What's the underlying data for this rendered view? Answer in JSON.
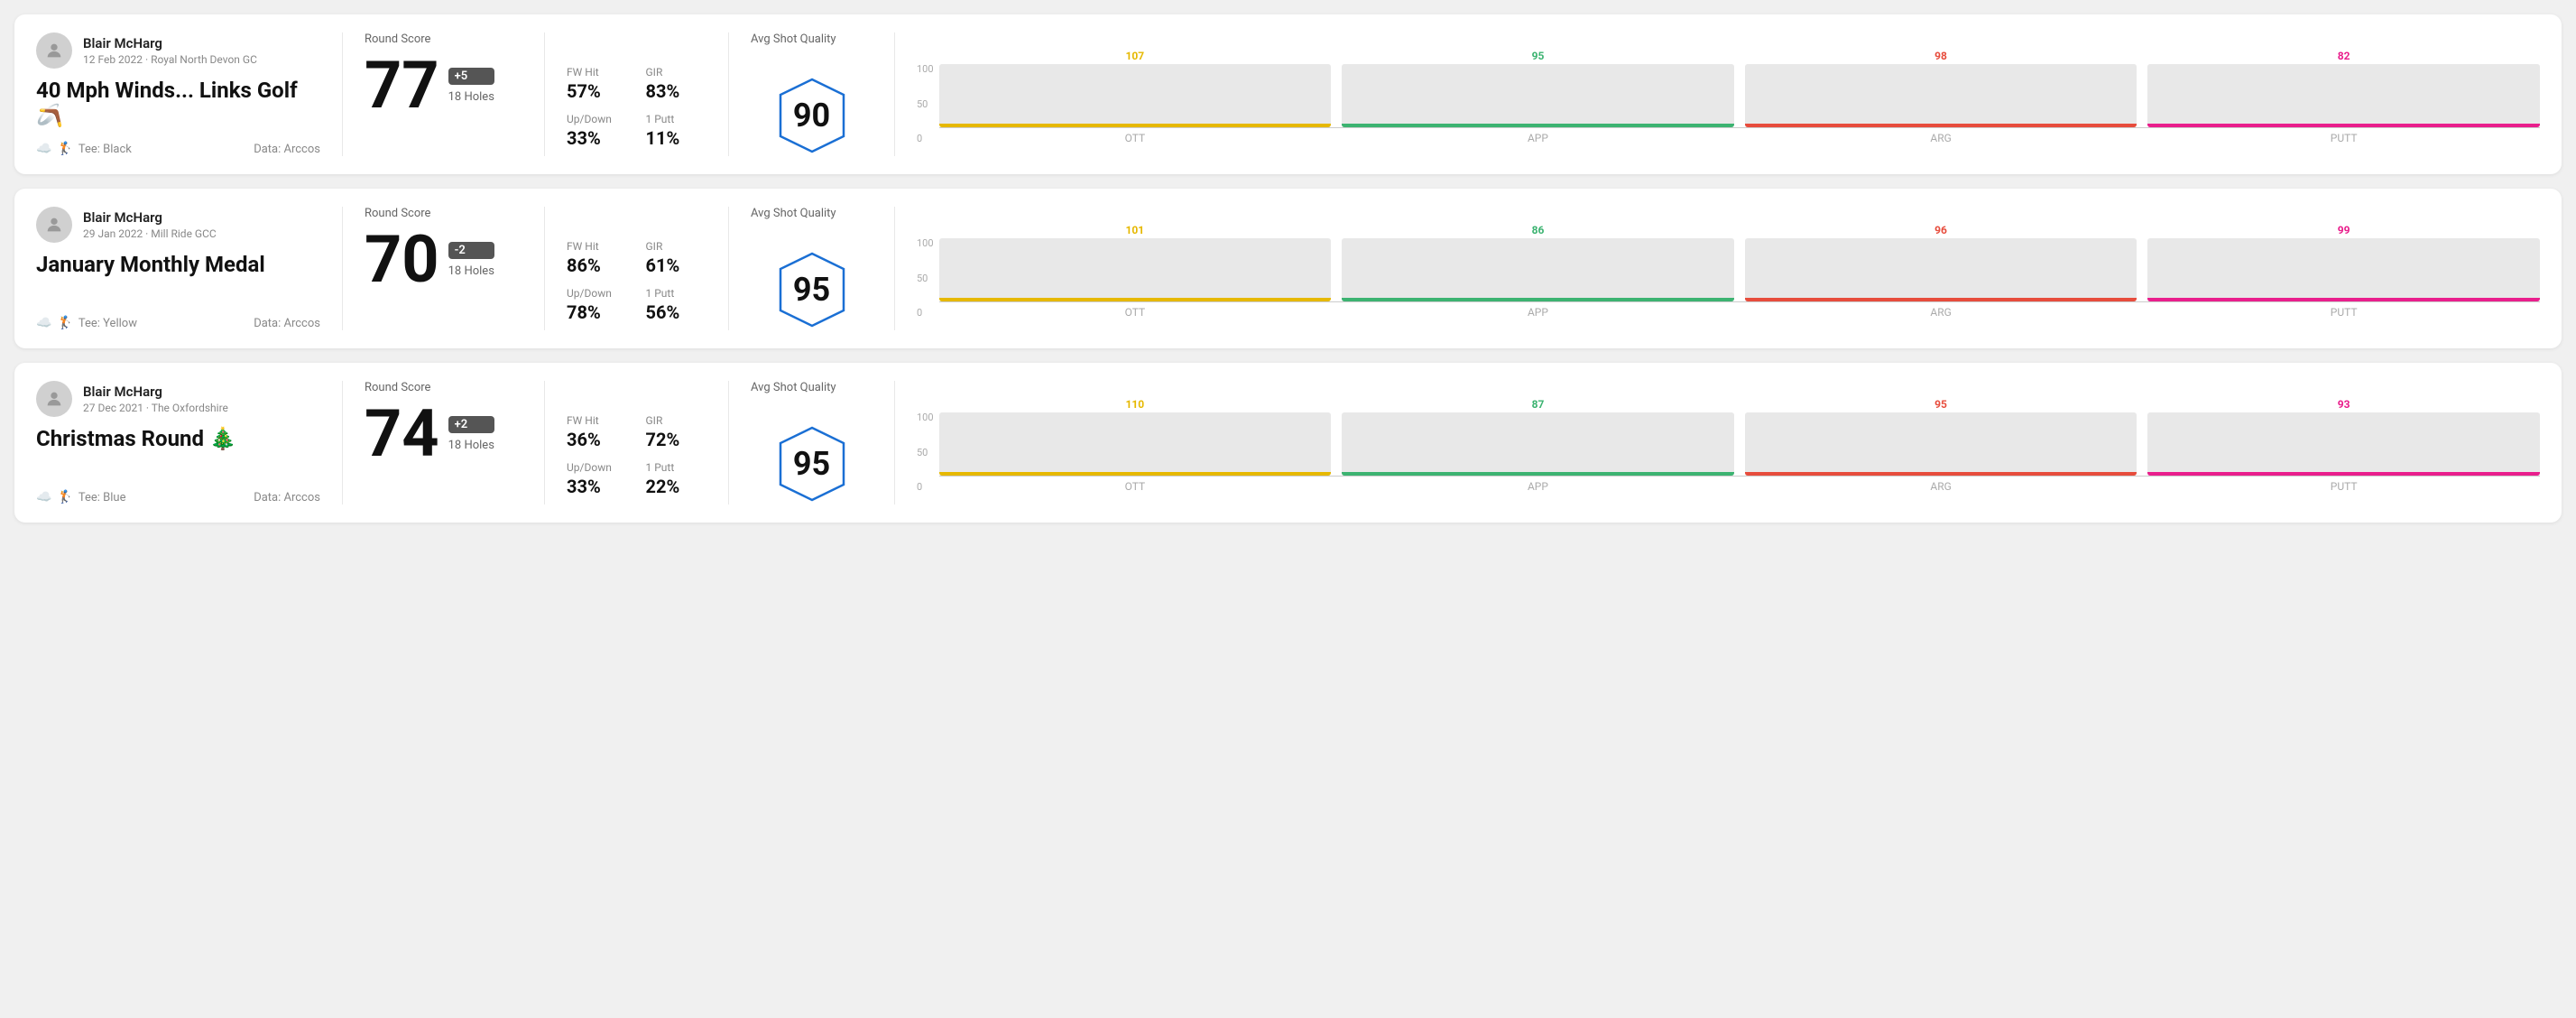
{
  "rounds": [
    {
      "id": "round-1",
      "user": {
        "name": "Blair McHarg",
        "date_course": "12 Feb 2022 · Royal North Devon GC"
      },
      "title": "40 Mph Winds... Links Golf 🪃",
      "tee": "Black",
      "data_source": "Data: Arccos",
      "score": "77",
      "score_badge": "+5",
      "score_holes": "18 Holes",
      "fw_hit": "57%",
      "gir": "83%",
      "up_down": "33%",
      "one_putt": "11%",
      "avg_shot_quality_label": "Avg Shot Quality",
      "avg_shot_quality": "90",
      "chart": {
        "bars": [
          {
            "label": "OTT",
            "value": 107,
            "color": "#e6b800",
            "fill_pct": 80
          },
          {
            "label": "APP",
            "value": 95,
            "color": "#3cb371",
            "fill_pct": 65
          },
          {
            "label": "ARG",
            "value": 98,
            "color": "#e74c3c",
            "fill_pct": 70
          },
          {
            "label": "PUTT",
            "value": 82,
            "color": "#e91e8c",
            "fill_pct": 55
          }
        ]
      }
    },
    {
      "id": "round-2",
      "user": {
        "name": "Blair McHarg",
        "date_course": "29 Jan 2022 · Mill Ride GCC"
      },
      "title": "January Monthly Medal",
      "tee": "Yellow",
      "data_source": "Data: Arccos",
      "score": "70",
      "score_badge": "-2",
      "score_holes": "18 Holes",
      "fw_hit": "86%",
      "gir": "61%",
      "up_down": "78%",
      "one_putt": "56%",
      "avg_shot_quality_label": "Avg Shot Quality",
      "avg_shot_quality": "95",
      "chart": {
        "bars": [
          {
            "label": "OTT",
            "value": 101,
            "color": "#e6b800",
            "fill_pct": 78
          },
          {
            "label": "APP",
            "value": 86,
            "color": "#3cb371",
            "fill_pct": 60
          },
          {
            "label": "ARG",
            "value": 96,
            "color": "#e74c3c",
            "fill_pct": 72
          },
          {
            "label": "PUTT",
            "value": 99,
            "color": "#e91e8c",
            "fill_pct": 75
          }
        ]
      }
    },
    {
      "id": "round-3",
      "user": {
        "name": "Blair McHarg",
        "date_course": "27 Dec 2021 · The Oxfordshire"
      },
      "title": "Christmas Round 🎄",
      "tee": "Blue",
      "data_source": "Data: Arccos",
      "score": "74",
      "score_badge": "+2",
      "score_holes": "18 Holes",
      "fw_hit": "36%",
      "gir": "72%",
      "up_down": "33%",
      "one_putt": "22%",
      "avg_shot_quality_label": "Avg Shot Quality",
      "avg_shot_quality": "95",
      "chart": {
        "bars": [
          {
            "label": "OTT",
            "value": 110,
            "color": "#e6b800",
            "fill_pct": 85
          },
          {
            "label": "APP",
            "value": 87,
            "color": "#3cb371",
            "fill_pct": 62
          },
          {
            "label": "ARG",
            "value": 95,
            "color": "#e74c3c",
            "fill_pct": 72
          },
          {
            "label": "PUTT",
            "value": 93,
            "color": "#e91e8c",
            "fill_pct": 70
          }
        ]
      }
    }
  ],
  "labels": {
    "round_score": "Round Score",
    "fw_hit": "FW Hit",
    "gir": "GIR",
    "up_down": "Up/Down",
    "one_putt": "1 Putt",
    "avg_shot_quality": "Avg Shot Quality",
    "tee_prefix": "Tee: ",
    "y_axis": [
      "100",
      "50",
      "0"
    ]
  }
}
